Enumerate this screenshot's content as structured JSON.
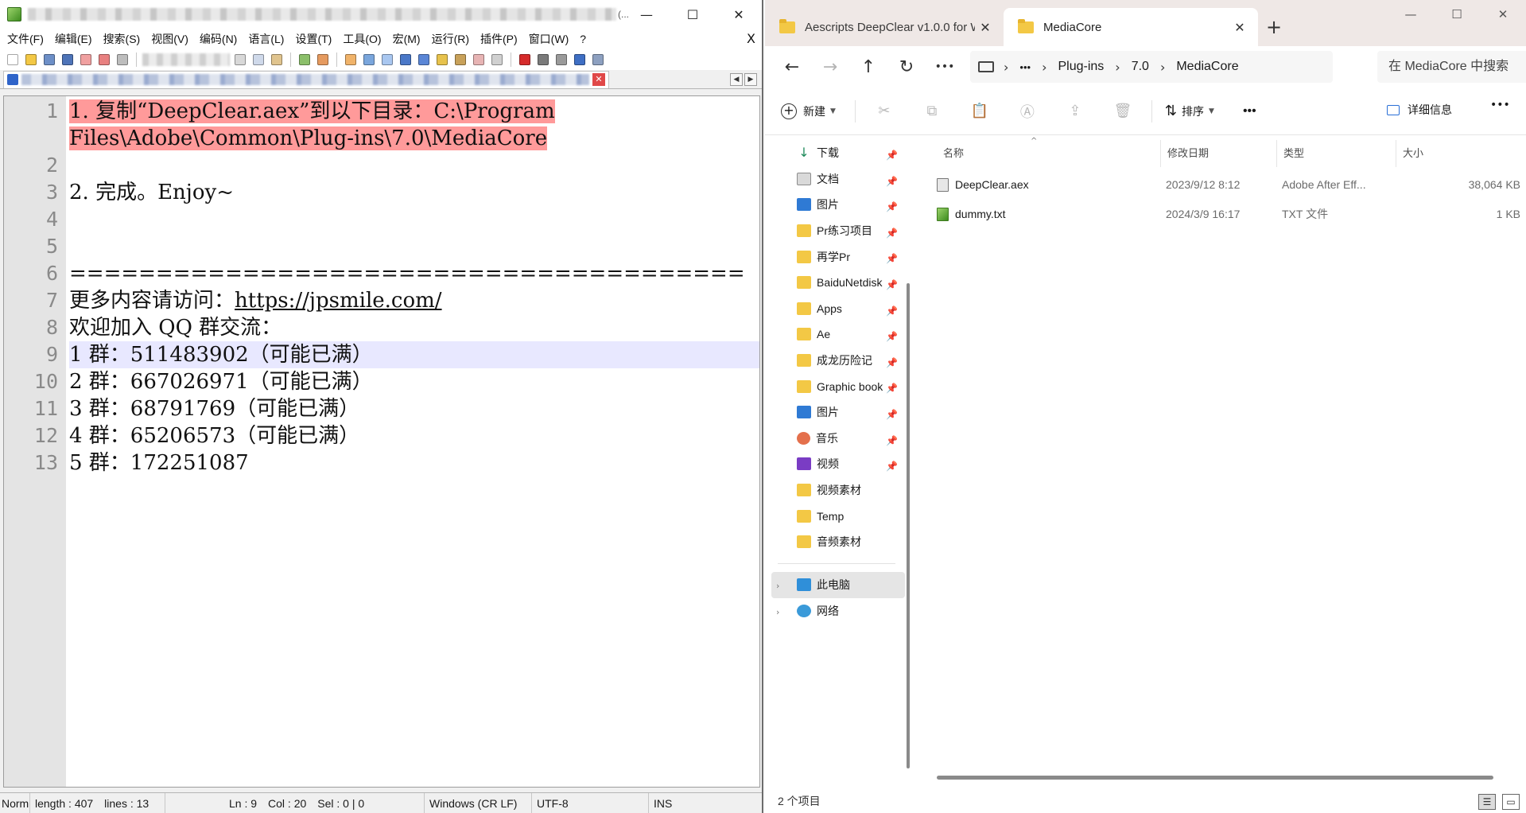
{
  "notepad": {
    "title_tail": "(...",
    "win": {
      "minimize": "—",
      "maximize": "☐",
      "close": "✕"
    },
    "menu": [
      "文件(F)",
      "编辑(E)",
      "搜索(S)",
      "视图(V)",
      "编码(N)",
      "语言(L)",
      "设置(T)",
      "工具(O)",
      "宏(M)",
      "运行(R)",
      "插件(P)",
      "窗口(W)",
      "?"
    ],
    "menu_close": "X",
    "tab_close": "✕",
    "lines": [
      {
        "n": "1",
        "text": "1. 复制“DeepClear.aex”到以下目录：C:\\Program",
        "hl": true
      },
      {
        "n": "",
        "text": "Files\\Adobe\\Common\\Plug-ins\\7.0\\MediaCore",
        "hl": true
      },
      {
        "n": "2",
        "text": ""
      },
      {
        "n": "3",
        "text": "2. 完成。Enjoy~"
      },
      {
        "n": "4",
        "text": ""
      },
      {
        "n": "5",
        "text": ""
      },
      {
        "n": "6",
        "text": "======================================="
      },
      {
        "n": "7",
        "prefix": "更多内容请访问：",
        "link": "https://jpsmile.com/"
      },
      {
        "n": "8",
        "text": "欢迎加入 QQ 群交流："
      },
      {
        "n": "9",
        "text": "1 群：511483902（可能已满）",
        "active": true
      },
      {
        "n": "10",
        "text": "2 群：667026971（可能已满）"
      },
      {
        "n": "11",
        "text": "3 群：68791769（可能已满）"
      },
      {
        "n": "12",
        "text": "4 群：65206573（可能已满）"
      },
      {
        "n": "13",
        "text": "5 群：172251087"
      }
    ],
    "status": {
      "mode": "Norm",
      "length": "length : 407",
      "lines": "lines : 13",
      "ln": "Ln : 9",
      "col": "Col : 20",
      "sel": "Sel : 0 | 0",
      "eol": "Windows (CR LF)",
      "encoding": "UTF-8",
      "ins": "INS"
    }
  },
  "explorer": {
    "tabs": [
      {
        "label": "Aescripts DeepClear v1.0.0 for W",
        "close": "✕"
      },
      {
        "label": "MediaCore",
        "close": "✕"
      }
    ],
    "new_tab": "+",
    "win": {
      "minimize": "—",
      "maximize": "☐",
      "close": "✕"
    },
    "nav": {
      "back": "←",
      "forward": "→",
      "up": "↑",
      "refresh": "↻",
      "more": "•••"
    },
    "address": {
      "more": "•••",
      "sep": "›",
      "crumbs": [
        "Plug-ins",
        "7.0",
        "MediaCore"
      ]
    },
    "search_placeholder": "在 MediaCore 中搜索",
    "cmd": {
      "new": "新建",
      "sort": "排序",
      "more": "•••",
      "details": "详细信息",
      "more_right": "•••",
      "icons": {
        "cut": "✂",
        "copy": "⧉",
        "paste": "📋",
        "rename": "Ⓐ",
        "share": "⇪",
        "delete": "🗑"
      }
    },
    "sidebar": [
      {
        "icon": "download",
        "label": "下载",
        "pin": true
      },
      {
        "icon": "doc",
        "label": "文档",
        "pin": true
      },
      {
        "icon": "pic",
        "label": "图片",
        "pin": true
      },
      {
        "icon": "folder",
        "label": "Pr练习项目",
        "pin": true
      },
      {
        "icon": "folder",
        "label": "再学Pr",
        "pin": true
      },
      {
        "icon": "folder",
        "label": "BaiduNetdisk",
        "pin": true
      },
      {
        "icon": "folder",
        "label": "Apps",
        "pin": true
      },
      {
        "icon": "folder",
        "label": "Ae",
        "pin": true
      },
      {
        "icon": "folder",
        "label": "成龙历险记",
        "pin": true
      },
      {
        "icon": "folder",
        "label": "Graphic book",
        "pin": true
      },
      {
        "icon": "pic",
        "label": "图片",
        "pin": true
      },
      {
        "icon": "music",
        "label": "音乐",
        "pin": true
      },
      {
        "icon": "video",
        "label": "视频",
        "pin": true
      },
      {
        "icon": "folder",
        "label": "视频素材",
        "pin": false
      },
      {
        "icon": "folder",
        "label": "Temp",
        "pin": false
      },
      {
        "icon": "folder",
        "label": "音频素材",
        "pin": false
      }
    ],
    "sidebar_bottom": [
      {
        "icon": "pc",
        "label": "此电脑",
        "selected": true
      },
      {
        "icon": "net",
        "label": "网络",
        "selected": false
      }
    ],
    "columns": {
      "name": "名称",
      "date": "修改日期",
      "type": "类型",
      "size": "大小"
    },
    "files": [
      {
        "icon": "aex",
        "name": "DeepClear.aex",
        "date": "2023/9/12 8:12",
        "type": "Adobe After Eff...",
        "size": "38,064 KB"
      },
      {
        "icon": "txt",
        "name": "dummy.txt",
        "date": "2024/3/9 16:17",
        "type": "TXT 文件",
        "size": "1 KB"
      }
    ],
    "status": "2 个项目"
  }
}
